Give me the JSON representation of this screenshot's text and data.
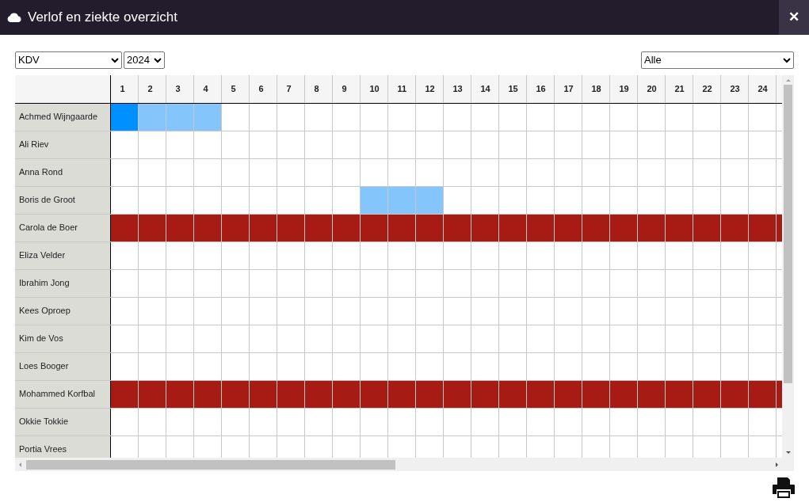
{
  "window": {
    "title": "Verlof en ziekte overzicht",
    "close_label": "✕"
  },
  "filters": {
    "group": "KDV",
    "year": "2024",
    "type": "Alle"
  },
  "table": {
    "columns": [
      "1",
      "2",
      "3",
      "4",
      "5",
      "6",
      "7",
      "8",
      "9",
      "10",
      "11",
      "12",
      "13",
      "14",
      "15",
      "16",
      "17",
      "18",
      "19",
      "20",
      "21",
      "22",
      "23",
      "24"
    ],
    "rows": [
      {
        "name": "Achmed Wijngaarde",
        "cells": [
          {
            "kind": "leave_first"
          },
          {
            "kind": "leave"
          },
          {
            "kind": "leave"
          },
          {
            "kind": "leave"
          },
          {
            "kind": "free"
          },
          {
            "kind": "free"
          },
          {
            "kind": "free"
          },
          {
            "kind": "free"
          },
          {
            "kind": "free"
          },
          {
            "kind": "free"
          },
          {
            "kind": "free"
          },
          {
            "kind": "free"
          },
          {
            "kind": "free"
          },
          {
            "kind": "free"
          },
          {
            "kind": "free"
          },
          {
            "kind": "free"
          },
          {
            "kind": "free"
          },
          {
            "kind": "free"
          },
          {
            "kind": "free"
          },
          {
            "kind": "free"
          },
          {
            "kind": "free"
          },
          {
            "kind": "free"
          },
          {
            "kind": "free"
          },
          {
            "kind": "free"
          },
          {
            "kind": "free"
          }
        ]
      },
      {
        "name": "Ali Riev",
        "cells": [
          {
            "kind": "free"
          },
          {
            "kind": "free"
          },
          {
            "kind": "free"
          },
          {
            "kind": "free"
          },
          {
            "kind": "free"
          },
          {
            "kind": "free"
          },
          {
            "kind": "free"
          },
          {
            "kind": "free"
          },
          {
            "kind": "free"
          },
          {
            "kind": "free"
          },
          {
            "kind": "free"
          },
          {
            "kind": "free"
          },
          {
            "kind": "free"
          },
          {
            "kind": "free"
          },
          {
            "kind": "free"
          },
          {
            "kind": "free"
          },
          {
            "kind": "free"
          },
          {
            "kind": "free"
          },
          {
            "kind": "free"
          },
          {
            "kind": "free"
          },
          {
            "kind": "free"
          },
          {
            "kind": "free"
          },
          {
            "kind": "free"
          },
          {
            "kind": "free"
          },
          {
            "kind": "free"
          }
        ]
      },
      {
        "name": "Anna Rond",
        "cells": [
          {
            "kind": "free"
          },
          {
            "kind": "free"
          },
          {
            "kind": "free"
          },
          {
            "kind": "free"
          },
          {
            "kind": "free"
          },
          {
            "kind": "free"
          },
          {
            "kind": "free"
          },
          {
            "kind": "free"
          },
          {
            "kind": "free"
          },
          {
            "kind": "free"
          },
          {
            "kind": "free"
          },
          {
            "kind": "free"
          },
          {
            "kind": "free"
          },
          {
            "kind": "free"
          },
          {
            "kind": "free"
          },
          {
            "kind": "free"
          },
          {
            "kind": "free"
          },
          {
            "kind": "free"
          },
          {
            "kind": "free"
          },
          {
            "kind": "free"
          },
          {
            "kind": "free"
          },
          {
            "kind": "free"
          },
          {
            "kind": "free"
          },
          {
            "kind": "free"
          },
          {
            "kind": "free"
          }
        ]
      },
      {
        "name": "Boris de Groot",
        "cells": [
          {
            "kind": "free"
          },
          {
            "kind": "free"
          },
          {
            "kind": "free"
          },
          {
            "kind": "free"
          },
          {
            "kind": "free"
          },
          {
            "kind": "free"
          },
          {
            "kind": "free"
          },
          {
            "kind": "free"
          },
          {
            "kind": "free"
          },
          {
            "kind": "leave"
          },
          {
            "kind": "leave"
          },
          {
            "kind": "leave"
          },
          {
            "kind": "free"
          },
          {
            "kind": "free"
          },
          {
            "kind": "free"
          },
          {
            "kind": "free"
          },
          {
            "kind": "free"
          },
          {
            "kind": "free"
          },
          {
            "kind": "free"
          },
          {
            "kind": "free"
          },
          {
            "kind": "free"
          },
          {
            "kind": "free"
          },
          {
            "kind": "free"
          },
          {
            "kind": "free"
          },
          {
            "kind": "free"
          }
        ]
      },
      {
        "name": "Carola de Boer",
        "cells": [
          {
            "kind": "sick"
          },
          {
            "kind": "sick"
          },
          {
            "kind": "sick"
          },
          {
            "kind": "sick"
          },
          {
            "kind": "sick"
          },
          {
            "kind": "sick"
          },
          {
            "kind": "sick"
          },
          {
            "kind": "sick"
          },
          {
            "kind": "sick"
          },
          {
            "kind": "sick"
          },
          {
            "kind": "sick"
          },
          {
            "kind": "sick"
          },
          {
            "kind": "sick"
          },
          {
            "kind": "sick"
          },
          {
            "kind": "sick"
          },
          {
            "kind": "sick"
          },
          {
            "kind": "sick"
          },
          {
            "kind": "sick"
          },
          {
            "kind": "sick"
          },
          {
            "kind": "sick"
          },
          {
            "kind": "sick"
          },
          {
            "kind": "sick"
          },
          {
            "kind": "sick"
          },
          {
            "kind": "sick"
          },
          {
            "kind": "sick"
          }
        ]
      },
      {
        "name": "Eliza Velder",
        "cells": [
          {
            "kind": "free"
          },
          {
            "kind": "free"
          },
          {
            "kind": "free"
          },
          {
            "kind": "free"
          },
          {
            "kind": "free"
          },
          {
            "kind": "free"
          },
          {
            "kind": "free"
          },
          {
            "kind": "free"
          },
          {
            "kind": "free"
          },
          {
            "kind": "free"
          },
          {
            "kind": "free"
          },
          {
            "kind": "free"
          },
          {
            "kind": "free"
          },
          {
            "kind": "free"
          },
          {
            "kind": "free"
          },
          {
            "kind": "free"
          },
          {
            "kind": "free"
          },
          {
            "kind": "free"
          },
          {
            "kind": "free"
          },
          {
            "kind": "free"
          },
          {
            "kind": "free"
          },
          {
            "kind": "free"
          },
          {
            "kind": "free"
          },
          {
            "kind": "free"
          },
          {
            "kind": "free"
          }
        ]
      },
      {
        "name": "Ibrahim Jong",
        "cells": [
          {
            "kind": "free"
          },
          {
            "kind": "free"
          },
          {
            "kind": "free"
          },
          {
            "kind": "free"
          },
          {
            "kind": "free"
          },
          {
            "kind": "free"
          },
          {
            "kind": "free"
          },
          {
            "kind": "free"
          },
          {
            "kind": "free"
          },
          {
            "kind": "free"
          },
          {
            "kind": "free"
          },
          {
            "kind": "free"
          },
          {
            "kind": "free"
          },
          {
            "kind": "free"
          },
          {
            "kind": "free"
          },
          {
            "kind": "free"
          },
          {
            "kind": "free"
          },
          {
            "kind": "free"
          },
          {
            "kind": "free"
          },
          {
            "kind": "free"
          },
          {
            "kind": "free"
          },
          {
            "kind": "free"
          },
          {
            "kind": "free"
          },
          {
            "kind": "free"
          },
          {
            "kind": "free"
          }
        ]
      },
      {
        "name": "Kees Oproep",
        "cells": [
          {
            "kind": "free"
          },
          {
            "kind": "free"
          },
          {
            "kind": "free"
          },
          {
            "kind": "free"
          },
          {
            "kind": "free"
          },
          {
            "kind": "free"
          },
          {
            "kind": "free"
          },
          {
            "kind": "free"
          },
          {
            "kind": "free"
          },
          {
            "kind": "free"
          },
          {
            "kind": "free"
          },
          {
            "kind": "free"
          },
          {
            "kind": "free"
          },
          {
            "kind": "free"
          },
          {
            "kind": "free"
          },
          {
            "kind": "free"
          },
          {
            "kind": "free"
          },
          {
            "kind": "free"
          },
          {
            "kind": "free"
          },
          {
            "kind": "free"
          },
          {
            "kind": "free"
          },
          {
            "kind": "free"
          },
          {
            "kind": "free"
          },
          {
            "kind": "free"
          },
          {
            "kind": "free"
          }
        ]
      },
      {
        "name": "Kim de Vos",
        "cells": [
          {
            "kind": "free"
          },
          {
            "kind": "free"
          },
          {
            "kind": "free"
          },
          {
            "kind": "free"
          },
          {
            "kind": "free"
          },
          {
            "kind": "free"
          },
          {
            "kind": "free"
          },
          {
            "kind": "free"
          },
          {
            "kind": "free"
          },
          {
            "kind": "free"
          },
          {
            "kind": "free"
          },
          {
            "kind": "free"
          },
          {
            "kind": "free"
          },
          {
            "kind": "free"
          },
          {
            "kind": "free"
          },
          {
            "kind": "free"
          },
          {
            "kind": "free"
          },
          {
            "kind": "free"
          },
          {
            "kind": "free"
          },
          {
            "kind": "free"
          },
          {
            "kind": "free"
          },
          {
            "kind": "free"
          },
          {
            "kind": "free"
          },
          {
            "kind": "free"
          },
          {
            "kind": "free"
          }
        ]
      },
      {
        "name": "Loes Booger",
        "cells": [
          {
            "kind": "free"
          },
          {
            "kind": "free"
          },
          {
            "kind": "free"
          },
          {
            "kind": "free"
          },
          {
            "kind": "free"
          },
          {
            "kind": "free"
          },
          {
            "kind": "free"
          },
          {
            "kind": "free"
          },
          {
            "kind": "free"
          },
          {
            "kind": "free"
          },
          {
            "kind": "free"
          },
          {
            "kind": "free"
          },
          {
            "kind": "free"
          },
          {
            "kind": "free"
          },
          {
            "kind": "free"
          },
          {
            "kind": "free"
          },
          {
            "kind": "free"
          },
          {
            "kind": "free"
          },
          {
            "kind": "free"
          },
          {
            "kind": "free"
          },
          {
            "kind": "free"
          },
          {
            "kind": "free"
          },
          {
            "kind": "free"
          },
          {
            "kind": "free"
          },
          {
            "kind": "free"
          }
        ]
      },
      {
        "name": "Mohammed Korfbal",
        "cells": [
          {
            "kind": "sick"
          },
          {
            "kind": "sick"
          },
          {
            "kind": "sick"
          },
          {
            "kind": "sick"
          },
          {
            "kind": "sick"
          },
          {
            "kind": "sick"
          },
          {
            "kind": "sick"
          },
          {
            "kind": "sick"
          },
          {
            "kind": "sick"
          },
          {
            "kind": "sick"
          },
          {
            "kind": "sick"
          },
          {
            "kind": "sick"
          },
          {
            "kind": "sick"
          },
          {
            "kind": "sick"
          },
          {
            "kind": "sick"
          },
          {
            "kind": "sick"
          },
          {
            "kind": "sick"
          },
          {
            "kind": "sick"
          },
          {
            "kind": "sick"
          },
          {
            "kind": "sick"
          },
          {
            "kind": "sick"
          },
          {
            "kind": "sick"
          },
          {
            "kind": "sick"
          },
          {
            "kind": "sick"
          },
          {
            "kind": "sick"
          }
        ]
      },
      {
        "name": "Okkie Tokkie",
        "cells": [
          {
            "kind": "free"
          },
          {
            "kind": "free"
          },
          {
            "kind": "free"
          },
          {
            "kind": "free"
          },
          {
            "kind": "free"
          },
          {
            "kind": "free"
          },
          {
            "kind": "free"
          },
          {
            "kind": "free"
          },
          {
            "kind": "free"
          },
          {
            "kind": "free"
          },
          {
            "kind": "free"
          },
          {
            "kind": "free"
          },
          {
            "kind": "free"
          },
          {
            "kind": "free"
          },
          {
            "kind": "free"
          },
          {
            "kind": "free"
          },
          {
            "kind": "free"
          },
          {
            "kind": "free"
          },
          {
            "kind": "free"
          },
          {
            "kind": "free"
          },
          {
            "kind": "free"
          },
          {
            "kind": "free"
          },
          {
            "kind": "free"
          },
          {
            "kind": "free"
          },
          {
            "kind": "free"
          }
        ]
      },
      {
        "name": "Portia Vrees",
        "cells": [
          {
            "kind": "free"
          },
          {
            "kind": "free"
          },
          {
            "kind": "free"
          },
          {
            "kind": "free"
          },
          {
            "kind": "free"
          },
          {
            "kind": "free"
          },
          {
            "kind": "free"
          },
          {
            "kind": "free"
          },
          {
            "kind": "free"
          },
          {
            "kind": "free"
          },
          {
            "kind": "free"
          },
          {
            "kind": "free"
          },
          {
            "kind": "free"
          },
          {
            "kind": "free"
          },
          {
            "kind": "free"
          },
          {
            "kind": "free"
          },
          {
            "kind": "free"
          },
          {
            "kind": "free"
          },
          {
            "kind": "free"
          },
          {
            "kind": "free"
          },
          {
            "kind": "free"
          },
          {
            "kind": "free"
          },
          {
            "kind": "free"
          },
          {
            "kind": "free"
          },
          {
            "kind": "free"
          }
        ]
      }
    ]
  }
}
